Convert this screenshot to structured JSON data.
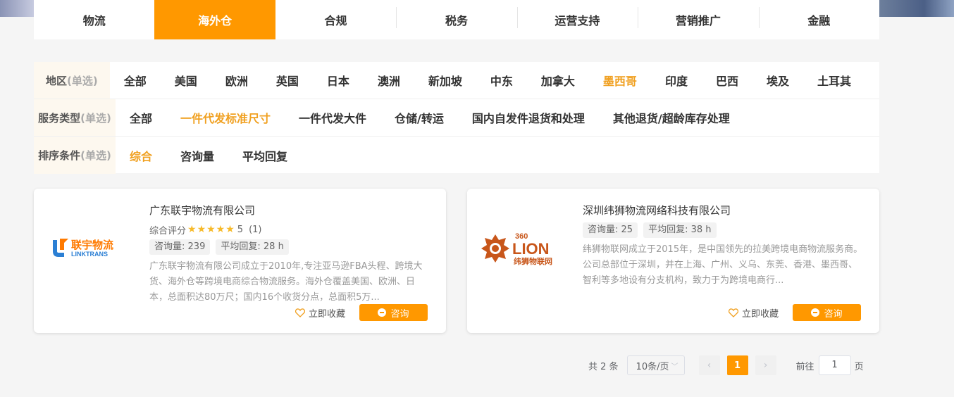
{
  "nav": {
    "tabs": [
      "物流",
      "海外仓",
      "合规",
      "税务",
      "运营支持",
      "营销推广",
      "金融"
    ],
    "active_index": 1
  },
  "filters": [
    {
      "label": "地区",
      "hint": "(单选)",
      "options": [
        "全部",
        "美国",
        "欧洲",
        "英国",
        "日本",
        "澳洲",
        "新加坡",
        "中东",
        "加拿大",
        "墨西哥",
        "印度",
        "巴西",
        "埃及",
        "土耳其"
      ],
      "active_index": 9
    },
    {
      "label": "服务类型",
      "hint": "(单选)",
      "options": [
        "全部",
        "一件代发标准尺寸",
        "一件代发大件",
        "仓储/转运",
        "国内自发件退货和处理",
        "其他退货/超龄库存处理"
      ],
      "active_index": 1
    },
    {
      "label": "排序条件",
      "hint": "(单选)",
      "options": [
        "综合",
        "咨询量",
        "平均回复"
      ],
      "active_index": 0
    }
  ],
  "cards": [
    {
      "company": "广东联宇物流有限公司",
      "rating_label": "综合评分",
      "stars": 5,
      "score": "5",
      "reviews": "(1)",
      "inquiries_label": "咨询量:",
      "inquiries": "239",
      "reply_label": "平均回复:",
      "reply": "28 h",
      "description": "广东联宇物流有限公司成立于2010年,专注亚马逊FBA头程、跨境大货、海外仓等跨境电商综合物流服务。海外仓覆盖美国、欧洲、日本，总面积达80万尺；国内16个收货分点，总面积5万...",
      "logo_text": "联宇物流",
      "logo_sub": "LINKTRANS",
      "favorite": "立即收藏",
      "consult": "咨询"
    },
    {
      "company": "深圳纬狮物流网络科技有限公司",
      "inquiries_label": "咨询量:",
      "inquiries": "25",
      "reply_label": "平均回复:",
      "reply": "38 h",
      "description": "纬狮物联网成立于2015年，是中国领先的拉美跨境电商物流服务商。 公司总部位于深圳，并在上海、广州、义乌、东莞、香港、墨西哥、智利等多地设有分支机构，致力于为跨境电商行...",
      "logo_text": "LION",
      "logo_num": "360",
      "logo_sub": "纬狮物联网",
      "favorite": "立即收藏",
      "consult": "咨询"
    }
  ],
  "pagination": {
    "total": "共 2 条",
    "page_size": "10条/页",
    "current": "1",
    "goto_label": "前往",
    "goto_value": "1",
    "goto_unit": "页"
  },
  "colors": {
    "accent": "#ff9800",
    "active_text": "#f0a020"
  }
}
